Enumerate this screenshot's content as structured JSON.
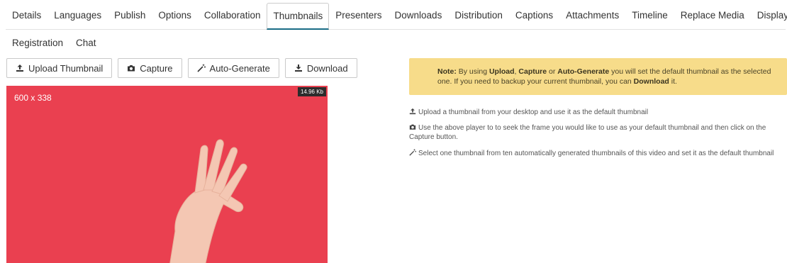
{
  "tabs_row1": [
    "Details",
    "Languages",
    "Publish",
    "Options",
    "Collaboration",
    "Thumbnails",
    "Presenters",
    "Downloads",
    "Distribution",
    "Captions",
    "Attachments",
    "Timeline",
    "Replace Media",
    "Display"
  ],
  "tabs_row2": [
    "Registration",
    "Chat"
  ],
  "active_tab": "Thumbnails",
  "toolbar": {
    "upload_label": "Upload Thumbnail",
    "capture_label": "Capture",
    "autogen_label": "Auto-Generate",
    "download_label": "Download"
  },
  "thumbnail": {
    "dimensions": "600 x 338",
    "file_size": "14.96 Kb",
    "background_color": "#ea4050"
  },
  "note": {
    "prefix": "Note:",
    "t1": " By using ",
    "k1": "Upload",
    "t2": ", ",
    "k2": "Capture",
    "t3": " or ",
    "k3": "Auto-Generate",
    "t4": " you will set the default thumbnail as the selected one. If you need to backup your current thumbnail, you can ",
    "k4": "Download",
    "t5": " it."
  },
  "help": {
    "upload": "Upload a thumbnail from your desktop and use it as the default thumbnail",
    "capture": "Use the above player to to seek the frame you would like to use as your default thumbnail and then click on the Capture button.",
    "autogen": "Select one thumbnail from ten automatically generated thumbnails of this video and set it as the default thumbnail"
  },
  "colors": {
    "accent": "#1a6c86",
    "note_bg": "#f7dc8a"
  }
}
